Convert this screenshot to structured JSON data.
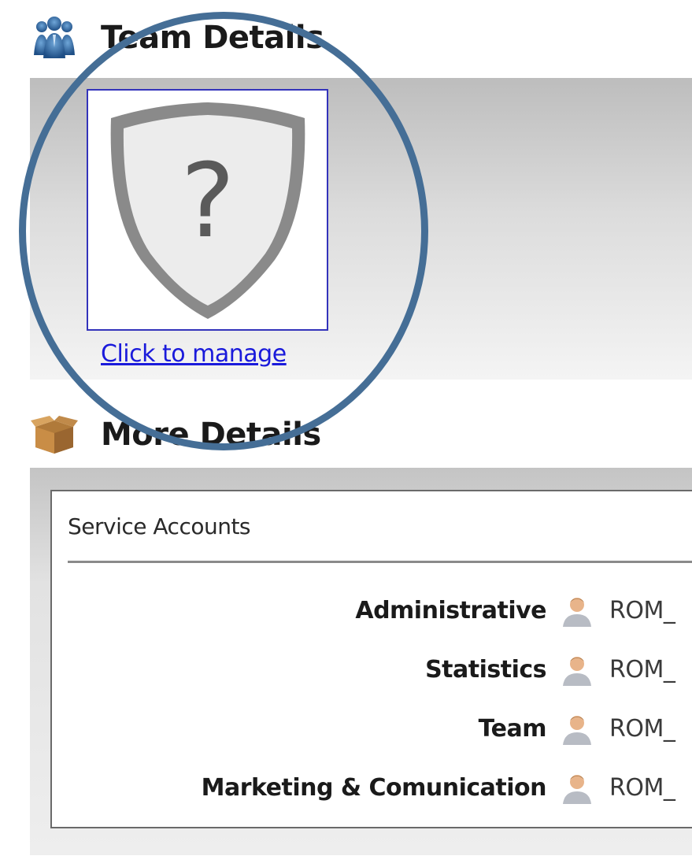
{
  "team_section": {
    "title": "Team Details",
    "icon": "team-icon",
    "logo_icon": "shield-question-icon",
    "manage_link": "Click to manage"
  },
  "more_section": {
    "title": "More Details",
    "icon": "box-icon",
    "service_accounts": {
      "title": "Service Accounts",
      "rows": [
        {
          "label": "Administrative",
          "value": "ROM_",
          "icon": "user-icon"
        },
        {
          "label": "Statistics",
          "value": "ROM_",
          "icon": "user-icon"
        },
        {
          "label": "Team",
          "value": "ROM_",
          "icon": "user-icon"
        },
        {
          "label": "Marketing & Comunication",
          "value": "ROM_",
          "icon": "user-icon"
        }
      ]
    }
  },
  "colors": {
    "link": "#1a1adb",
    "highlight_ring": "#456e96",
    "logo_border": "#3333bb"
  }
}
